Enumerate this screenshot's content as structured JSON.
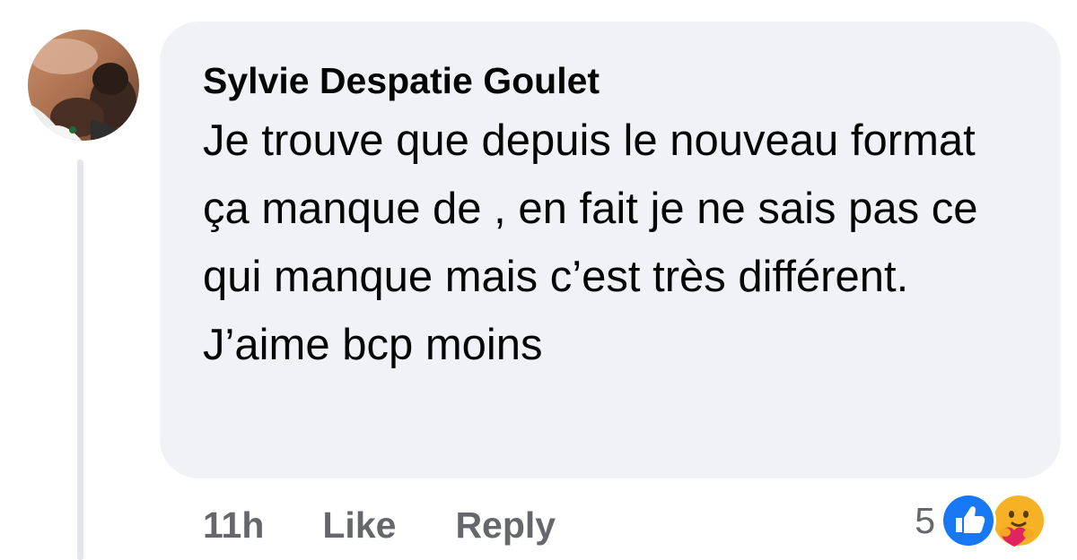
{
  "comment": {
    "author": "Sylvie Despatie Goulet",
    "text": "Je trouve que depuis le nouveau format ça manque de , en fait je ne sais pas ce qui manque mais c’est très différent. J’aime bcp moins"
  },
  "actions": {
    "time": "11h",
    "like_label": "Like",
    "reply_label": "Reply"
  },
  "reactions": {
    "count": "5",
    "icons": [
      "like-icon",
      "care-icon"
    ]
  },
  "colors": {
    "bubble": "#f0f2f5",
    "meta_text": "#65676b",
    "like_blue": "#1877f2",
    "care_yellow": "#f7b125"
  }
}
